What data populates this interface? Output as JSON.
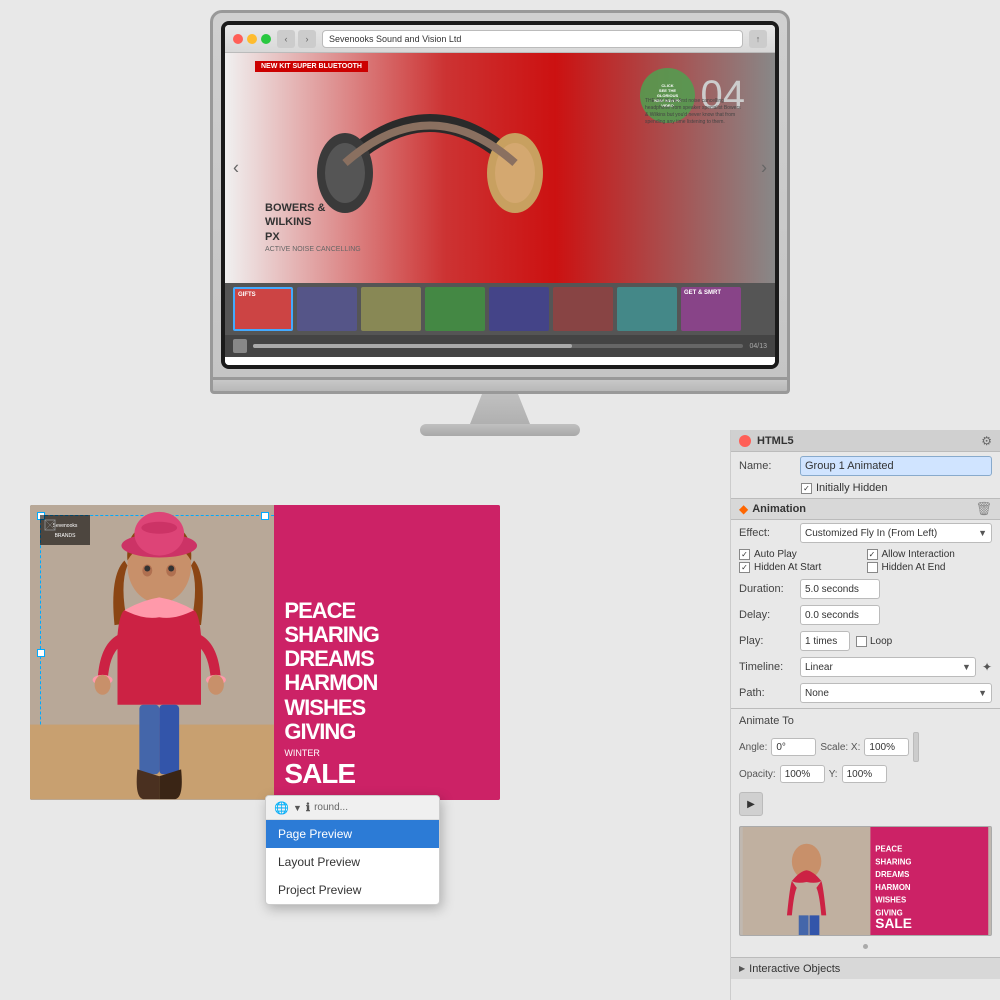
{
  "imac": {
    "url": "Sevenooks Sound and Vision Ltd",
    "hero_number": "04",
    "brand_name": "BOWERS &\nWILKINS\nPX",
    "hero_subtitle": "ACTIVE NOISE CANCELLING",
    "hero_banner": "NEW KIT SUPER BLUETOOTH",
    "cta_text": "CLICK\nSEE THE\nGLORIOUS\nNEW B&W PX\nVIDEO",
    "body_text": "THE PX IS the first noise cancelling headphone from speaker specialist Bowers & Wilkins but you'd never know that from spending any time listening to them."
  },
  "canvas": {
    "brand": "Sevenooks\nBRANDS",
    "peace_text": "PEACE\nSHARING\nDREAMS\nHARMON\nWISHES\nGIVING",
    "winter_text": "WINTER",
    "sale_text": "SALE"
  },
  "panel": {
    "title": "HTML5",
    "name_label": "Name:",
    "name_value": "Group 1 Animated",
    "initially_hidden_label": "Initially Hidden",
    "animation_section": "Animation",
    "effect_label": "Effect:",
    "effect_value": "Customized Fly In (From Left)",
    "checkboxes": [
      {
        "label": "Auto Play",
        "checked": true
      },
      {
        "label": "Allow Interaction",
        "checked": true
      },
      {
        "label": "Hidden At Start",
        "checked": true
      },
      {
        "label": "Hidden At End",
        "checked": false
      }
    ],
    "duration_label": "Duration:",
    "duration_value": "5.0 seconds",
    "delay_label": "Delay:",
    "delay_value": "0.0 seconds",
    "play_label": "Play:",
    "play_value": "1 times",
    "loop_label": "Loop",
    "timeline_label": "Timeline:",
    "timeline_value": "Linear",
    "path_label": "Path:",
    "path_value": "None",
    "animate_to_label": "Animate To",
    "angle_label": "Angle:",
    "angle_value": "0°",
    "scale_x_label": "Scale: X:",
    "scale_x_value": "100%",
    "opacity_label": "Opacity:",
    "opacity_value": "100%",
    "scale_y_label": "Y:",
    "scale_y_value": "100%",
    "interactive_objects_label": "Interactive Objects"
  },
  "dropdown": {
    "page_preview": "Page Preview",
    "layout_preview": "Layout Preview",
    "project_preview": "Project Preview"
  }
}
